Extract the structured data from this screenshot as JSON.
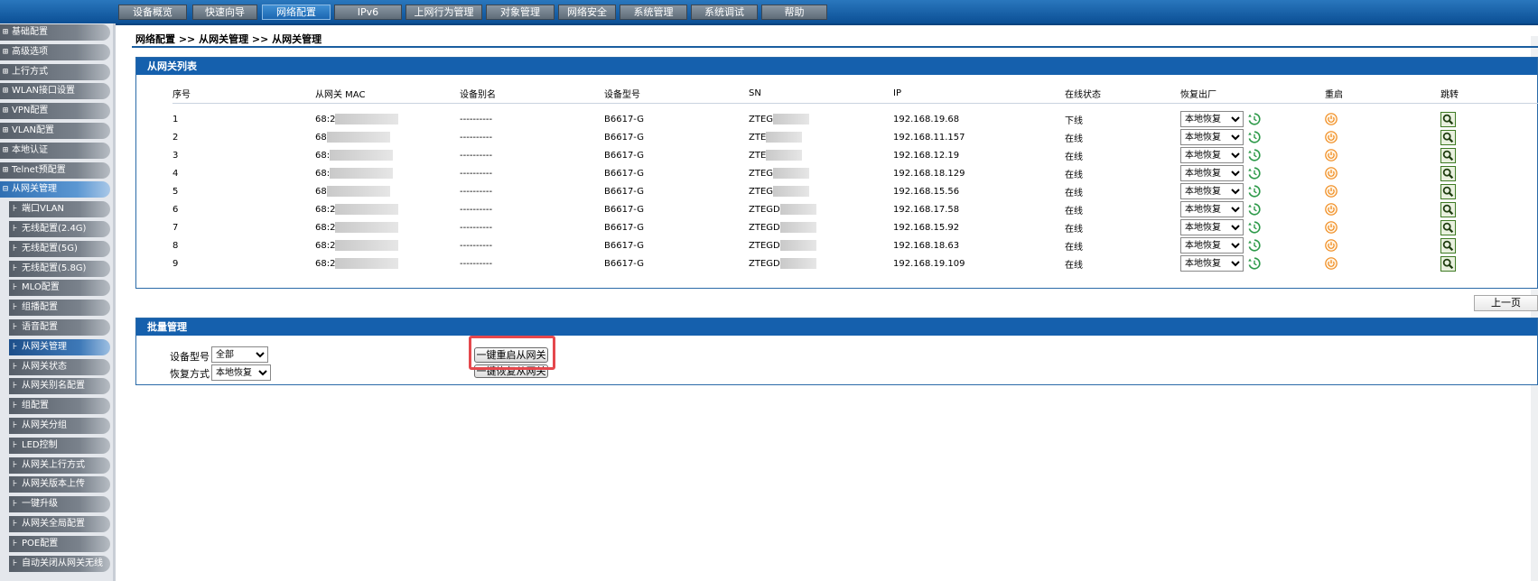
{
  "nav": {
    "tabs": [
      "设备概览",
      "快速向导",
      "网络配置",
      "IPv6",
      "上网行为管理",
      "对象管理",
      "网络安全",
      "系统管理",
      "系统调试",
      "帮助"
    ],
    "active": "网络配置"
  },
  "sidebar": {
    "top_items": [
      {
        "sym": "⊞",
        "label": "基础配置"
      },
      {
        "sym": "⊞",
        "label": "高级选项"
      },
      {
        "sym": "⊞",
        "label": "上行方式"
      },
      {
        "sym": "⊞",
        "label": "WLAN接口设置"
      },
      {
        "sym": "⊞",
        "label": "VPN配置"
      },
      {
        "sym": "⊞",
        "label": "VLAN配置"
      },
      {
        "sym": "⊞",
        "label": "本地认证"
      },
      {
        "sym": "⊞",
        "label": "Telnet预配置"
      },
      {
        "sym": "⊟",
        "label": "从网关管理"
      }
    ],
    "sub_items": [
      "端口VLAN",
      "无线配置(2.4G)",
      "无线配置(5G)",
      "无线配置(5.8G)",
      "MLO配置",
      "组播配置",
      "语音配置",
      "从网关管理",
      "从网关状态",
      "从网关别名配置",
      "组配置",
      "从网关分组",
      "LED控制",
      "从网关上行方式",
      "从网关版本上传",
      "一键升级",
      "从网关全局配置",
      "POE配置",
      "自动关闭从网关无线"
    ],
    "current": "从网关管理"
  },
  "breadcrumb": "网络配置 >> 从网关管理 >> 从网关管理",
  "list_panel": {
    "title": "从网关列表",
    "columns": [
      "序号",
      "从网关 MAC",
      "设备别名",
      "设备型号",
      "SN",
      "IP",
      "在线状态",
      "恢复出厂",
      "重启",
      "跳转"
    ],
    "rows": [
      {
        "no": "1",
        "mac": "68:2",
        "alias": "----------",
        "model": "B6617-G",
        "sn": "ZTEG",
        "ip": "192.168.19.68",
        "status": "下线",
        "restore": "本地恢复"
      },
      {
        "no": "2",
        "mac": "68",
        "alias": "----------",
        "model": "B6617-G",
        "sn": "ZTE",
        "ip": "192.168.11.157",
        "status": "在线",
        "restore": "本地恢复"
      },
      {
        "no": "3",
        "mac": "68:",
        "alias": "----------",
        "model": "B6617-G",
        "sn": "ZTE",
        "ip": "192.168.12.19",
        "status": "在线",
        "restore": "本地恢复"
      },
      {
        "no": "4",
        "mac": "68:",
        "alias": "----------",
        "model": "B6617-G",
        "sn": "ZTEG",
        "ip": "192.168.18.129",
        "status": "在线",
        "restore": "本地恢复"
      },
      {
        "no": "5",
        "mac": "68",
        "alias": "----------",
        "model": "B6617-G",
        "sn": "ZTEG",
        "ip": "192.168.15.56",
        "status": "在线",
        "restore": "本地恢复"
      },
      {
        "no": "6",
        "mac": "68:2",
        "alias": "----------",
        "model": "B6617-G",
        "sn": "ZTEGD",
        "ip": "192.168.17.58",
        "status": "在线",
        "restore": "本地恢复"
      },
      {
        "no": "7",
        "mac": "68:2",
        "alias": "----------",
        "model": "B6617-G",
        "sn": "ZTEGD",
        "ip": "192.168.15.92",
        "status": "在线",
        "restore": "本地恢复"
      },
      {
        "no": "8",
        "mac": "68:2",
        "alias": "----------",
        "model": "B6617-G",
        "sn": "ZTEGD",
        "ip": "192.168.18.63",
        "status": "在线",
        "restore": "本地恢复"
      },
      {
        "no": "9",
        "mac": "68:2",
        "alias": "----------",
        "model": "B6617-G",
        "sn": "ZTEGD",
        "ip": "192.168.19.109",
        "status": "在线",
        "restore": "本地恢复"
      }
    ]
  },
  "pager": {
    "prev_label": "上一页"
  },
  "batch_panel": {
    "title": "批量管理",
    "model_label": "设备型号",
    "model_value": "全部",
    "restore_label": "恢复方式",
    "restore_value": "本地恢复",
    "reboot_all_label": "一键重启从网关",
    "restore_all_label": "一键恢复从网关"
  },
  "icons": {
    "restore": "restore-history-icon",
    "reboot": "power-icon",
    "jump": "search-magnifier-icon"
  },
  "colors": {
    "nav_bar": "#0b4f95",
    "panel_header": "#1560ad",
    "restore_icon": "#2e9a4a",
    "reboot_icon": "#f08a1c",
    "jump_icon": "#3e7a23",
    "highlight": "#e5484d"
  }
}
